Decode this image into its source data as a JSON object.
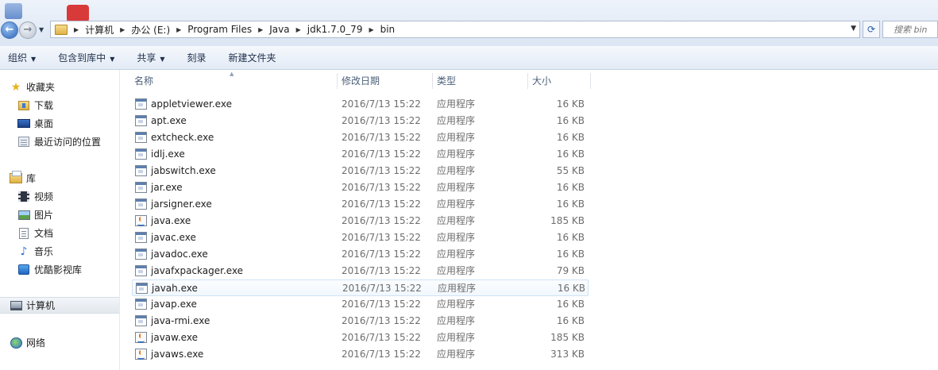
{
  "address": {
    "crumbs": [
      "计算机",
      "办公 (E:)",
      "Program Files",
      "Java",
      "jdk1.7.0_79",
      "bin"
    ]
  },
  "search": {
    "placeholder": "搜索 bin"
  },
  "toolbar": {
    "organize": "组织",
    "include_library": "包含到库中",
    "share": "共享",
    "burn": "刻录",
    "new_folder": "新建文件夹"
  },
  "sidebar": {
    "favorites": "收藏夹",
    "downloads": "下载",
    "desktop": "桌面",
    "recent": "最近访问的位置",
    "libraries": "库",
    "videos": "视频",
    "pictures": "图片",
    "documents": "文档",
    "music": "音乐",
    "youku": "优酷影视库",
    "computer": "计算机",
    "network": "网络"
  },
  "columns": {
    "name": "名称",
    "date": "修改日期",
    "type": "类型",
    "size": "大小"
  },
  "files": [
    {
      "name": "appletviewer.exe",
      "date": "2016/7/13 15:22",
      "type": "应用程序",
      "size": "16 KB",
      "icon": "exe-icon"
    },
    {
      "name": "apt.exe",
      "date": "2016/7/13 15:22",
      "type": "应用程序",
      "size": "16 KB",
      "icon": "exe-icon"
    },
    {
      "name": "extcheck.exe",
      "date": "2016/7/13 15:22",
      "type": "应用程序",
      "size": "16 KB",
      "icon": "exe-icon"
    },
    {
      "name": "idlj.exe",
      "date": "2016/7/13 15:22",
      "type": "应用程序",
      "size": "16 KB",
      "icon": "exe-icon"
    },
    {
      "name": "jabswitch.exe",
      "date": "2016/7/13 15:22",
      "type": "应用程序",
      "size": "55 KB",
      "icon": "exe-icon"
    },
    {
      "name": "jar.exe",
      "date": "2016/7/13 15:22",
      "type": "应用程序",
      "size": "16 KB",
      "icon": "exe-icon"
    },
    {
      "name": "jarsigner.exe",
      "date": "2016/7/13 15:22",
      "type": "应用程序",
      "size": "16 KB",
      "icon": "exe-icon"
    },
    {
      "name": "java.exe",
      "date": "2016/7/13 15:22",
      "type": "应用程序",
      "size": "185 KB",
      "icon": "java-icon"
    },
    {
      "name": "javac.exe",
      "date": "2016/7/13 15:22",
      "type": "应用程序",
      "size": "16 KB",
      "icon": "exe-icon"
    },
    {
      "name": "javadoc.exe",
      "date": "2016/7/13 15:22",
      "type": "应用程序",
      "size": "16 KB",
      "icon": "exe-icon"
    },
    {
      "name": "javafxpackager.exe",
      "date": "2016/7/13 15:22",
      "type": "应用程序",
      "size": "79 KB",
      "icon": "exe-icon"
    },
    {
      "name": "javah.exe",
      "date": "2016/7/13 15:22",
      "type": "应用程序",
      "size": "16 KB",
      "icon": "exe-icon"
    },
    {
      "name": "javap.exe",
      "date": "2016/7/13 15:22",
      "type": "应用程序",
      "size": "16 KB",
      "icon": "exe-icon"
    },
    {
      "name": "java-rmi.exe",
      "date": "2016/7/13 15:22",
      "type": "应用程序",
      "size": "16 KB",
      "icon": "exe-icon"
    },
    {
      "name": "javaw.exe",
      "date": "2016/7/13 15:22",
      "type": "应用程序",
      "size": "185 KB",
      "icon": "java-icon"
    },
    {
      "name": "javaws.exe",
      "date": "2016/7/13 15:22",
      "type": "应用程序",
      "size": "313 KB",
      "icon": "java-icon"
    }
  ],
  "colors": {
    "accent": "#2b63b8",
    "hover_row": "#f1f7fd",
    "header_text": "#4c607a"
  }
}
